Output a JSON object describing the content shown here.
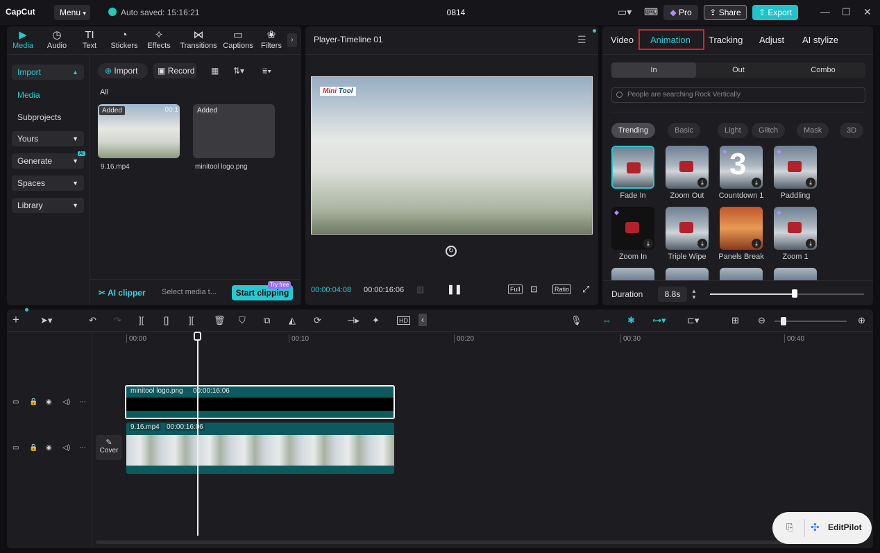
{
  "topbar": {
    "logo": "CapCut",
    "menu_label": "Menu",
    "autosave": "Auto saved: 15:16:21",
    "project_title": "0814",
    "pro_label": "Pro",
    "share_label": "Share",
    "export_label": "Export"
  },
  "media": {
    "tabs": [
      {
        "label": "Media",
        "icon": "▶"
      },
      {
        "label": "Audio",
        "icon": "◷"
      },
      {
        "label": "Text",
        "icon": "TI"
      },
      {
        "label": "Stickers",
        "icon": "◔"
      },
      {
        "label": "Effects",
        "icon": "✧"
      },
      {
        "label": "Transitions",
        "icon": "⋈"
      },
      {
        "label": "Captions",
        "icon": "▭"
      },
      {
        "label": "Filters",
        "icon": "❀"
      }
    ],
    "sidebar": {
      "import": "Import",
      "media": "Media",
      "subprojects": "Subprojects",
      "yours": "Yours",
      "generate": "Generate",
      "ai_badge": "AI",
      "spaces": "Spaces",
      "library": "Library"
    },
    "import_button": "Import",
    "record_button": "Record",
    "all_label": "All",
    "items": [
      {
        "name": "9.16.mp4",
        "badge": "Added",
        "duration": "00:1"
      },
      {
        "name": "minitool logo.png",
        "badge": "Added"
      }
    ],
    "ai_clipper": "AI clipper",
    "ai_hint": "Select media t...",
    "start_clipping": "Start clipping",
    "try_free": "Try free"
  },
  "player": {
    "title": "Player-Timeline 01",
    "watermark_a": "Mini",
    "watermark_b": "Tool",
    "time_current": "00:00:04:08",
    "time_total": "00:00:16:06",
    "full_label": "Full",
    "ratio_label": "Ratio"
  },
  "inspector": {
    "tabs": [
      "Video",
      "Animation",
      "Tracking",
      "Adjust",
      "AI stylize"
    ],
    "segments": [
      "In",
      "Out",
      "Combo"
    ],
    "search_placeholder": "People are searching Rock Vertically",
    "chips": [
      "Trending",
      "Basic",
      "Light",
      "Glitch",
      "Mask",
      "3D"
    ],
    "animations": [
      {
        "label": "Fade In"
      },
      {
        "label": "Zoom Out"
      },
      {
        "label": "Countdown 1",
        "glyph": "3"
      },
      {
        "label": "Paddling"
      },
      {
        "label": "Zoom In"
      },
      {
        "label": "Triple Wipe"
      },
      {
        "label": "Panels Break"
      },
      {
        "label": "Zoom 1"
      }
    ],
    "duration_label": "Duration",
    "duration_value": "8.8s",
    "duration_fraction": 0.55
  },
  "timeline": {
    "ruler": [
      "00:00",
      "00:10",
      "00:20",
      "00:30",
      "00:40"
    ],
    "clips": [
      {
        "name": "minitool logo.png",
        "duration": "00:00:16:06"
      },
      {
        "name": "9.16.mp4",
        "duration": "00:00:16:06"
      }
    ],
    "cover_label": "Cover",
    "hd_label": "HD",
    "editpilot": "EditPilot"
  },
  "colors": {
    "accent": "#27c9d0",
    "highlight_box": "#e0211f",
    "clip_track": "#0d5a5e"
  }
}
